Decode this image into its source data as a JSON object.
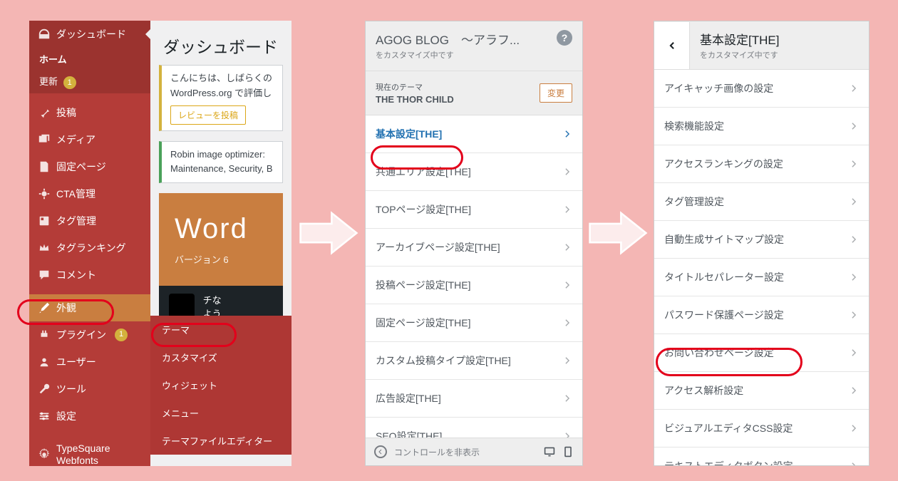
{
  "wp": {
    "dashboard_label": "ダッシュボード",
    "home_label": "ホーム",
    "updates_label": "更新",
    "updates_count": "1",
    "plugins_count": "1",
    "posts_label": "投稿",
    "media_label": "メディア",
    "pages_label": "固定ページ",
    "cta_label": "CTA管理",
    "tag_label": "タグ管理",
    "tagrank_label": "タグランキング",
    "comments_label": "コメント",
    "appearance_label": "外観",
    "plugins_label": "プラグイン",
    "users_label": "ユーザー",
    "tools_label": "ツール",
    "settings_label": "設定",
    "typesquare_label": "TypeSquare Webfonts",
    "flyout": {
      "themes": "テーマ",
      "customize": "カスタマイズ",
      "widgets": "ウィジェット",
      "menus": "メニュー",
      "editor": "テーマファイルエディター"
    },
    "content": {
      "h1": "ダッシュボード",
      "box1_line1": "こんにちは、しばらくの",
      "box1_line2": "WordPress.org で評価し",
      "box1_btn": "レビューを投稿",
      "box2_line1": "Robin image optimizer:",
      "box2_line2": "Maintenance, Security, B",
      "welcome_big": "Word",
      "welcome_sub": "バージョン 6",
      "welcome_strip1": "チな",
      "welcome_strip2": "よう"
    }
  },
  "customizer": {
    "site_title": "AGOG BLOG　～アラフ...",
    "site_sub": "をカスタマイズ中です",
    "help": "?",
    "theme_label": "現在のテーマ",
    "theme_name": "THE THOR CHILD",
    "change_btn": "変更",
    "rows": [
      "基本設定[THE]",
      "共通エリア設定[THE]",
      "TOPページ設定[THE]",
      "アーカイブページ設定[THE]",
      "投稿ページ設定[THE]",
      "固定ページ設定[THE]",
      "カスタム投稿タイプ設定[THE]",
      "広告設定[THE]",
      "SEO設定[THE]"
    ],
    "hide_controls": "コントロールを非表示"
  },
  "sub": {
    "title": "基本設定[THE]",
    "sub": "をカスタマイズ中です",
    "rows": [
      "アイキャッチ画像の設定",
      "検索機能設定",
      "アクセスランキングの設定",
      "タグ管理設定",
      "自動生成サイトマップ設定",
      "タイトルセパレーター設定",
      "パスワード保護ページ設定",
      "お問い合わせページ設定",
      "アクセス解析設定",
      "ビジュアルエディタCSS設定",
      "テキストエディタボタン設定"
    ]
  }
}
